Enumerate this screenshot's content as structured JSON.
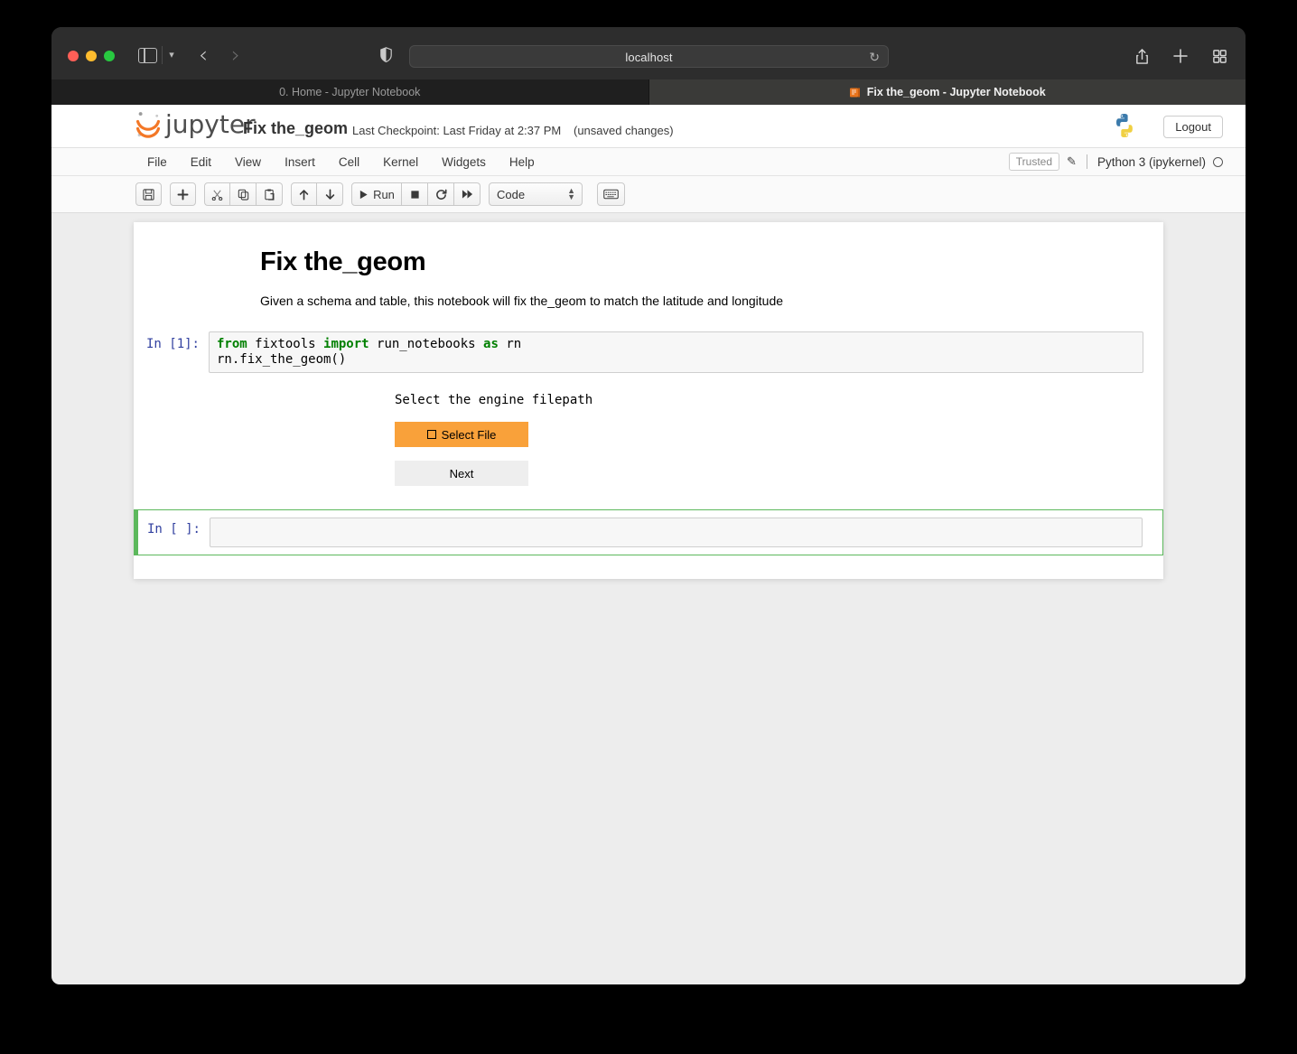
{
  "browser": {
    "url": "localhost",
    "reload_icon": "reload-icon",
    "shield_icon": "shield-icon",
    "share_icon": "share-icon",
    "new_tab_icon": "plus-icon",
    "tab_overview_icon": "grid-icon",
    "sidebar_icon": "sidebar-toggle-icon",
    "back_icon": "chevron-left-icon",
    "forward_icon": "chevron-right-icon",
    "tabs": [
      {
        "title": "0. Home - Jupyter Notebook",
        "active": false
      },
      {
        "title": "Fix the_geom - Jupyter Notebook",
        "active": true
      }
    ]
  },
  "jupyter": {
    "logo_text": "jupyter",
    "notebook_name": "Fix the_geom",
    "checkpoint": "Last Checkpoint: Last Friday at 2:37 PM",
    "save_state": "(unsaved changes)",
    "logout_label": "Logout",
    "menu": [
      "File",
      "Edit",
      "View",
      "Insert",
      "Cell",
      "Kernel",
      "Widgets",
      "Help"
    ],
    "trusted_label": "Trusted",
    "edit_icon": "pencil-icon",
    "kernel_name": "Python 3 (ipykernel)",
    "kernel_status": "kernel-idle-circle",
    "toolbar": {
      "save_icon": "save-floppy-icon",
      "insert_icon": "plus-icon",
      "cut_icon": "scissors-icon",
      "copy_icon": "copy-icon",
      "paste_icon": "paste-icon",
      "move_up_icon": "arrow-up-icon",
      "move_down_icon": "arrow-down-icon",
      "run_label": "Run",
      "run_icon": "play-icon",
      "stop_icon": "stop-square-icon",
      "restart_icon": "restart-circle-icon",
      "restart_run_all_icon": "fast-forward-icon",
      "cell_type": "Code",
      "command_palette_icon": "keyboard-icon"
    }
  },
  "notebook": {
    "heading": "Fix the_geom",
    "description": "Given a schema and table, this notebook will fix the_geom to match the latitude and longitude",
    "cells": [
      {
        "prompt": "In [1]:",
        "code_line1_kw1": "from",
        "code_line1_mid1": " fixtools ",
        "code_line1_kw2": "import",
        "code_line1_mid2": " run_notebooks ",
        "code_line1_kw3": "as",
        "code_line1_mid3": " rn",
        "code_line2": "rn.fix_the_geom()"
      },
      {
        "prompt": "In [ ]:",
        "code": ""
      }
    ],
    "widget": {
      "label": "Select the engine filepath",
      "select_file_label": "Select File",
      "select_file_icon": "checkbox-square-icon",
      "next_label": "Next",
      "select_file_color": "#f9a13a",
      "next_color": "#eeeeee"
    }
  }
}
